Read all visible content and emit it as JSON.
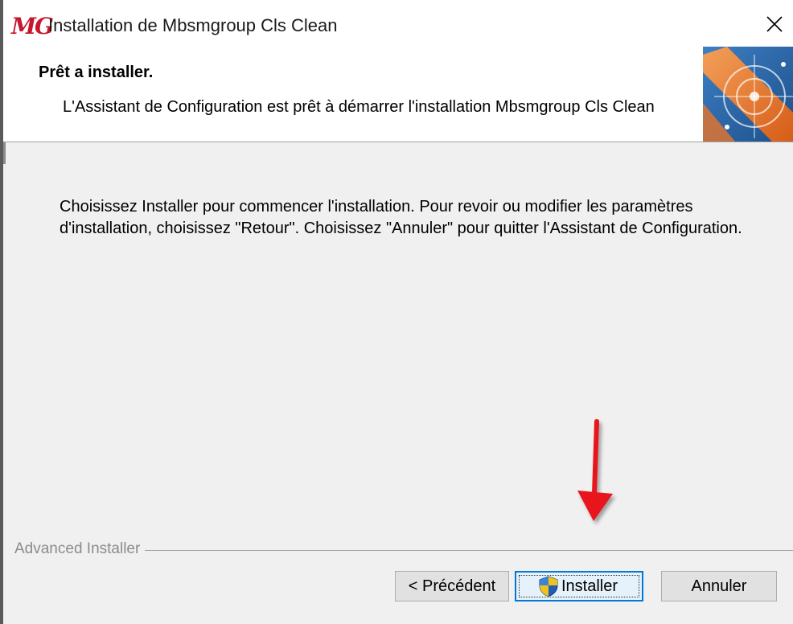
{
  "window": {
    "logo_text": "MG",
    "title": "Installation de Mbsmgroup Cls Clean",
    "close_symbol": "✕"
  },
  "header": {
    "title": "Prêt a installer.",
    "description": "L'Assistant de Configuration est prêt à démarrer l'installation Mbsmgroup Cls Clean"
  },
  "body": {
    "message": "Choisissez Installer pour commencer l'installation. Pour revoir ou modifier les paramètres d'installation, choisissez \"Retour\". Choisissez \"Annuler\" pour quitter l'Assistant de Configuration."
  },
  "footer": {
    "brand": "Advanced Installer",
    "buttons": {
      "back": "< Précédent",
      "install": "Installer",
      "cancel": "Annuler"
    }
  },
  "colors": {
    "logo": "#c8162c",
    "annotation_arrow": "#e8141b",
    "focus_border": "#0078d7",
    "graphic_orange": "#e8742a",
    "graphic_blue": "#2f6aa8"
  },
  "icons": {
    "close": "close-icon",
    "install_shield": "uac-shield-icon",
    "header_graphic": "installer-graphic"
  }
}
